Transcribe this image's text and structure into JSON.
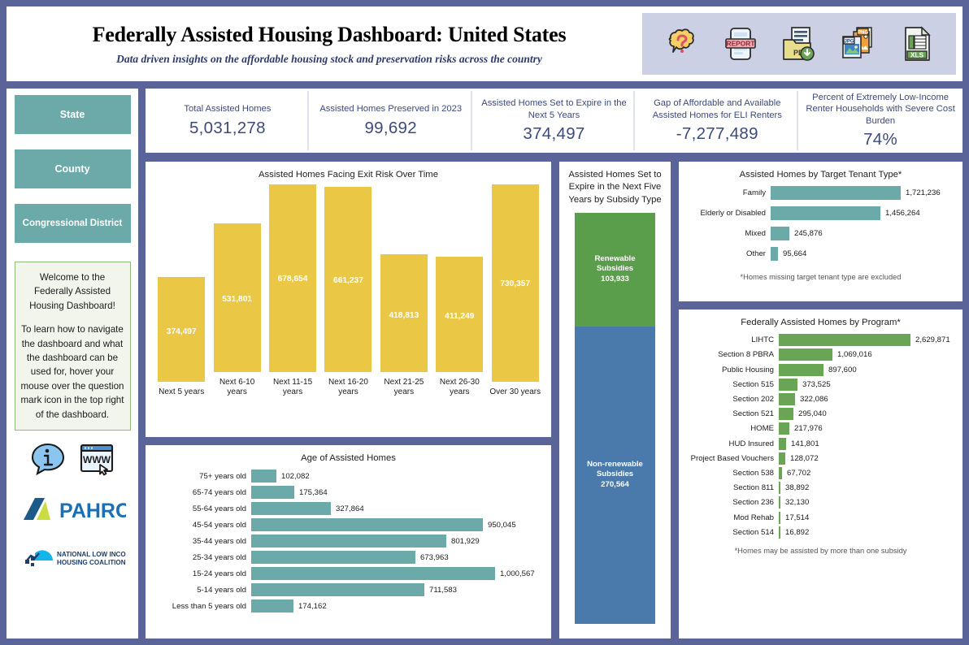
{
  "header": {
    "title": "Federally Assisted Housing Dashboard: United States",
    "subtitle": "Data driven insights on the affordable housing stock and preservation risks across the country",
    "icons": [
      {
        "name": "question-mark-icon",
        "label": "?"
      },
      {
        "name": "report-icon",
        "label": "REPORT"
      },
      {
        "name": "pdf-download-icon",
        "label": "PDF"
      },
      {
        "name": "image-download-icon",
        "label": "JPG PNG"
      },
      {
        "name": "excel-download-icon",
        "label": "XLS"
      }
    ]
  },
  "sidebar": {
    "nav": [
      {
        "label": "State"
      },
      {
        "label": "County"
      },
      {
        "label": "Congressional District"
      }
    ],
    "welcome_p1": "Welcome to the Federally Assisted Housing Dashboard!",
    "welcome_p2": "To learn how to navigate the dashboard and what the dashboard can be used for, hover your mouse over the question mark icon in the top right of the dashboard.",
    "logos": [
      {
        "name": "info-bubble-icon"
      },
      {
        "name": "website-icon"
      },
      {
        "name": "pahrc-logo",
        "text": "PAHRC"
      },
      {
        "name": "nlihc-logo",
        "line1": "NATIONAL LOW INCOME",
        "line2": "HOUSING COALITION"
      }
    ]
  },
  "kpis": [
    {
      "label": "Total Assisted Homes",
      "value": "5,031,278"
    },
    {
      "label": "Assisted Homes Preserved in 2023",
      "value": "99,692"
    },
    {
      "label": "Assisted Homes Set to Expire in the Next 5 Years",
      "value": "374,497"
    },
    {
      "label": "Gap of Affordable and Available Assisted Homes for ELI Renters",
      "value": "-7,277,489"
    },
    {
      "label": "Percent of Extremely Low-Income Renter Households with Severe Cost Burden",
      "value": "74%"
    }
  ],
  "colors": {
    "frame": "#5a6499",
    "yellow": "#eac845",
    "teal": "#6baaa8",
    "green": "#6aa555",
    "blue": "#4a7aab",
    "kpi_text": "#3d4a7d",
    "icon_bar_bg": "#ccd0e4"
  },
  "chart_data": [
    {
      "id": "exit-risk",
      "type": "bar",
      "title": "Assisted Homes Facing Exit Risk Over Time",
      "xlabel": "",
      "ylabel": "",
      "orientation": "vertical",
      "color": "#eac845",
      "categories": [
        "Next 5 years",
        "Next 6-10 years",
        "Next 11-15 years",
        "Next 16-20 years",
        "Next 21-25 years",
        "Next 26-30 years",
        "Over 30 years"
      ],
      "values": [
        374497,
        531801,
        678654,
        661237,
        418813,
        411249,
        730357
      ],
      "labels": [
        "374,497",
        "531,801",
        "678,654",
        "661,237",
        "418,813",
        "411,249",
        "730,357"
      ],
      "ylim": [
        0,
        730357
      ]
    },
    {
      "id": "age-of-homes",
      "type": "bar",
      "title": "Age of Assisted Homes",
      "orientation": "horizontal",
      "color": "#6baaa8",
      "categories": [
        "75+ years old",
        "65-74 years old",
        "55-64 years old",
        "45-54 years old",
        "35-44 years old",
        "25-34 years old",
        "15-24 years old",
        "5-14 years old",
        "Less than 5 years old"
      ],
      "values": [
        102082,
        175364,
        327864,
        950045,
        801929,
        673963,
        1000567,
        711583,
        174162
      ],
      "labels": [
        "102,082",
        "175,364",
        "327,864",
        "950,045",
        "801,929",
        "673,963",
        "1,000,567",
        "711,583",
        "174,162"
      ],
      "xlim": [
        0,
        1000567
      ]
    },
    {
      "id": "expire-by-subsidy-type",
      "type": "bar",
      "title": "Assisted Homes Set to Expire in the Next Five Years by Subsidy Type",
      "orientation": "stacked-vertical",
      "segments": [
        {
          "name": "Renewable Subsidies",
          "value": 103933,
          "label": "103,933",
          "color": "#5a9d4a"
        },
        {
          "name": "Non-renewable Subsidies",
          "value": 270564,
          "label": "270,564",
          "color": "#4a7aab"
        }
      ],
      "total": 374497
    },
    {
      "id": "target-tenant-type",
      "type": "bar",
      "title": "Assisted Homes by Target Tenant Type*",
      "orientation": "horizontal",
      "color": "#6baaa8",
      "footnote": "*Homes missing target tenant type are excluded",
      "categories": [
        "Family",
        "Elderly or Disabled",
        "Mixed",
        "Other"
      ],
      "values": [
        1721236,
        1456264,
        245876,
        95664
      ],
      "labels": [
        "1,721,236",
        "1,456,264",
        "245,876",
        "95,664"
      ],
      "xlim": [
        0,
        1721236
      ]
    },
    {
      "id": "homes-by-program",
      "type": "bar",
      "title": "Federally Assisted Homes by Program*",
      "orientation": "horizontal",
      "color": "#6aa555",
      "footnote": "*Homes may be assisted by more than one subsidy",
      "categories": [
        "LIHTC",
        "Section 8 PBRA",
        "Public Housing",
        "Section 515",
        "Section 202",
        "Section 521",
        "HOME",
        "HUD Insured",
        "Project Based Vouchers",
        "Section 538",
        "Section 811",
        "Section 236",
        "Mod Rehab",
        "Section 514"
      ],
      "values": [
        2629871,
        1069016,
        897600,
        373525,
        322086,
        295040,
        217976,
        141801,
        128072,
        67702,
        38892,
        32130,
        17514,
        16892
      ],
      "labels": [
        "2,629,871",
        "1,069,016",
        "897,600",
        "373,525",
        "322,086",
        "295,040",
        "217,976",
        "141,801",
        "128,072",
        "67,702",
        "38,892",
        "32,130",
        "17,514",
        "16,892"
      ],
      "xlim": [
        0,
        2629871
      ]
    }
  ]
}
